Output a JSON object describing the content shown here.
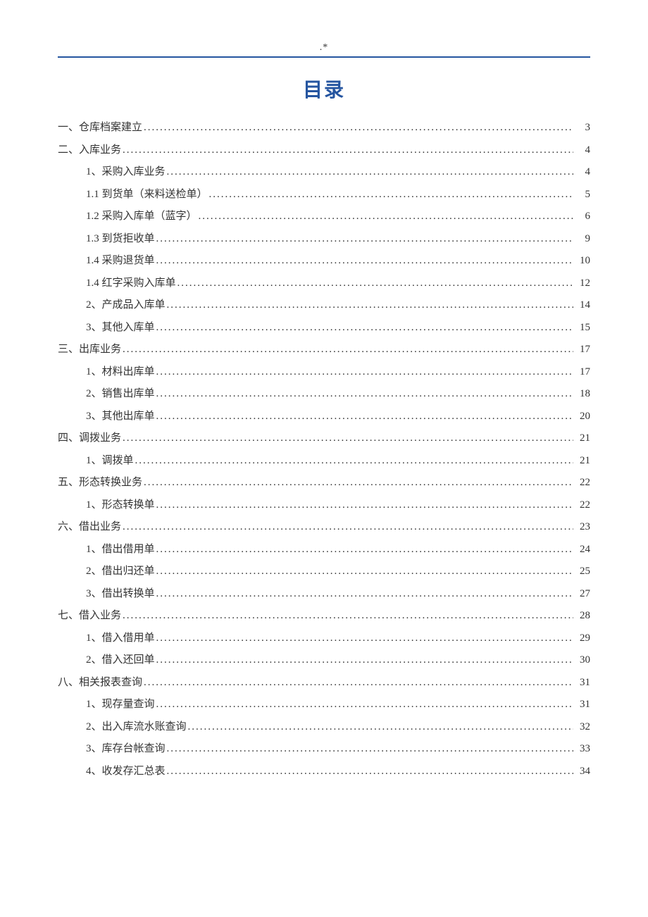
{
  "header_mark": ".*",
  "title": "目录",
  "entries": [
    {
      "level": 1,
      "label": "一、仓库档案建立",
      "page": "3"
    },
    {
      "level": 1,
      "label": "二、入库业务",
      "page": "4"
    },
    {
      "level": 2,
      "label": "1、采购入库业务",
      "page": "4"
    },
    {
      "level": 2,
      "label": "1.1 到货单（来料送检单）",
      "page": "5"
    },
    {
      "level": 2,
      "label": "1.2 采购入库单（蓝字）",
      "page": "6"
    },
    {
      "level": 2,
      "label": "1.3 到货拒收单",
      "page": "9"
    },
    {
      "level": 2,
      "label": "1.4 采购退货单",
      "page": "10"
    },
    {
      "level": 2,
      "label": "1.4 红字采购入库单",
      "page": "12"
    },
    {
      "level": 2,
      "label": "2、产成品入库单",
      "page": "14"
    },
    {
      "level": 2,
      "label": "3、其他入库单",
      "page": "15"
    },
    {
      "level": 1,
      "label": "三、出库业务",
      "page": "17"
    },
    {
      "level": 2,
      "label": "1、材料出库单",
      "page": "17"
    },
    {
      "level": 2,
      "label": "2、销售出库单",
      "page": "18"
    },
    {
      "level": 2,
      "label": "3、其他出库单",
      "page": "20"
    },
    {
      "level": 1,
      "label": "四、调拨业务",
      "page": "21"
    },
    {
      "level": 2,
      "label": "1、调拨单",
      "page": "21"
    },
    {
      "level": 1,
      "label": "五、形态转换业务",
      "page": "22"
    },
    {
      "level": 2,
      "label": "1、形态转换单",
      "page": "22"
    },
    {
      "level": 1,
      "label": "六、借出业务",
      "page": "23"
    },
    {
      "level": 2,
      "label": "1、借出借用单",
      "page": "24"
    },
    {
      "level": 2,
      "label": "2、借出归还单",
      "page": "25"
    },
    {
      "level": 2,
      "label": "3、借出转换单",
      "page": "27"
    },
    {
      "level": 1,
      "label": "七、借入业务",
      "page": "28"
    },
    {
      "level": 2,
      "label": "1、借入借用单",
      "page": "29"
    },
    {
      "level": 2,
      "label": "2、借入还回单",
      "page": "30"
    },
    {
      "level": 1,
      "label": "八、相关报表查询",
      "page": "31"
    },
    {
      "level": 2,
      "label": "1、现存量查询",
      "page": "31"
    },
    {
      "level": 2,
      "label": "2、出入库流水账查询",
      "page": "32"
    },
    {
      "level": 2,
      "label": "3、库存台帐查询",
      "page": "33"
    },
    {
      "level": 2,
      "label": "4、收发存汇总表",
      "page": "34"
    }
  ]
}
